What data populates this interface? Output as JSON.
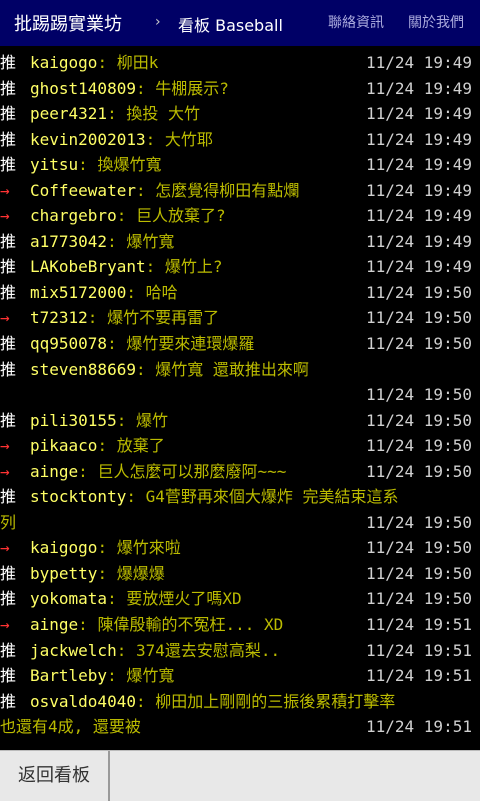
{
  "header": {
    "brand": "批踢踢實業坊",
    "chevron": "›",
    "board": "看板 Baseball",
    "contact": "聯絡資訊",
    "about": "關於我們"
  },
  "colors": {
    "header_bg": "#000066",
    "push_tag": "#ffffff",
    "arrow_tag": "#ff3333",
    "user": "#ffff66",
    "message": "#bbbb00",
    "time": "#d0d0d0"
  },
  "comments": [
    {
      "tag": "推",
      "kind": "push",
      "user": "kaigogo",
      "msg": ": 柳田k",
      "time": "11/24 19:49"
    },
    {
      "tag": "推",
      "kind": "push",
      "user": "ghost140809",
      "msg": ": 牛棚展示?",
      "time": "11/24 19:49"
    },
    {
      "tag": "推",
      "kind": "push",
      "user": "peer4321",
      "msg": ": 換投 大竹",
      "time": "11/24 19:49"
    },
    {
      "tag": "推",
      "kind": "push",
      "user": "kevin2002013",
      "msg": ": 大竹耶",
      "time": "11/24 19:49"
    },
    {
      "tag": "推",
      "kind": "push",
      "user": "yitsu",
      "msg": ": 換爆竹寬",
      "time": "11/24 19:49"
    },
    {
      "tag": "→",
      "kind": "arrow",
      "user": "Coffeewater",
      "msg": ": 怎麼覺得柳田有點爛",
      "time": "11/24 19:49"
    },
    {
      "tag": "→",
      "kind": "arrow",
      "user": "chargebro",
      "msg": ": 巨人放棄了?",
      "time": "11/24 19:49"
    },
    {
      "tag": "推",
      "kind": "push",
      "user": "a1773042",
      "msg": ": 爆竹寬",
      "time": "11/24 19:49"
    },
    {
      "tag": "推",
      "kind": "push",
      "user": "LAKobeBryant",
      "msg": ": 爆竹上?",
      "time": "11/24 19:49"
    },
    {
      "tag": "推",
      "kind": "push",
      "user": "mix5172000",
      "msg": ": 哈哈",
      "time": "11/24 19:50"
    },
    {
      "tag": "→",
      "kind": "arrow",
      "user": "t72312",
      "msg": ": 爆竹不要再雷了",
      "time": "11/24 19:50"
    },
    {
      "tag": "推",
      "kind": "push",
      "user": "qq950078",
      "msg": ": 爆竹要來連環爆羅",
      "time": "11/24 19:50"
    },
    {
      "tag": "推",
      "kind": "push",
      "user": "steven88669",
      "msg": ": 爆竹寬 還敢推出來啊",
      "time": "",
      "time_next_line": "11/24 19:50"
    },
    {
      "tag": "推",
      "kind": "push",
      "user": "pili30155",
      "msg": ": 爆竹",
      "time": "11/24 19:50"
    },
    {
      "tag": "→",
      "kind": "arrow",
      "user": "pikaaco",
      "msg": ": 放棄了",
      "time": "11/24 19:50"
    },
    {
      "tag": "→",
      "kind": "arrow",
      "user": "ainge",
      "msg": ": 巨人怎麼可以那麼廢阿~~~",
      "time": "11/24 19:50"
    },
    {
      "tag": "推",
      "kind": "push",
      "user": "stocktonty",
      "msg": ": G4菅野再來個大爆炸 完美結束這系",
      "continuation": "列",
      "time": "",
      "time_next_line": "11/24 19:50"
    },
    {
      "tag": "→",
      "kind": "arrow",
      "user": "kaigogo",
      "msg": ": 爆竹來啦",
      "time": "11/24 19:50"
    },
    {
      "tag": "推",
      "kind": "push",
      "user": "bypetty",
      "msg": ": 爆爆爆",
      "time": "11/24 19:50"
    },
    {
      "tag": "推",
      "kind": "push",
      "user": "yokomata",
      "msg": ": 要放煙火了嗎XD",
      "time": "11/24 19:50"
    },
    {
      "tag": "→",
      "kind": "arrow",
      "user": "ainge",
      "msg": ": 陳偉殷輸的不冤枉... XD",
      "time": "11/24 19:51"
    },
    {
      "tag": "推",
      "kind": "push",
      "user": "jackwelch",
      "msg": ": 374還去安慰高梨..",
      "time": "11/24 19:51"
    },
    {
      "tag": "推",
      "kind": "push",
      "user": "Bartleby",
      "msg": ": 爆竹寬",
      "time": "11/24 19:51"
    },
    {
      "tag": "推",
      "kind": "push",
      "user": "osvaldo4040",
      "msg": ": 柳田加上剛剛的三振後累積打擊率",
      "continuation": "也還有4成, 還要被",
      "time": "",
      "time_next_line": "11/24 19:51"
    }
  ],
  "footer": {
    "back_label": "返回看板"
  }
}
